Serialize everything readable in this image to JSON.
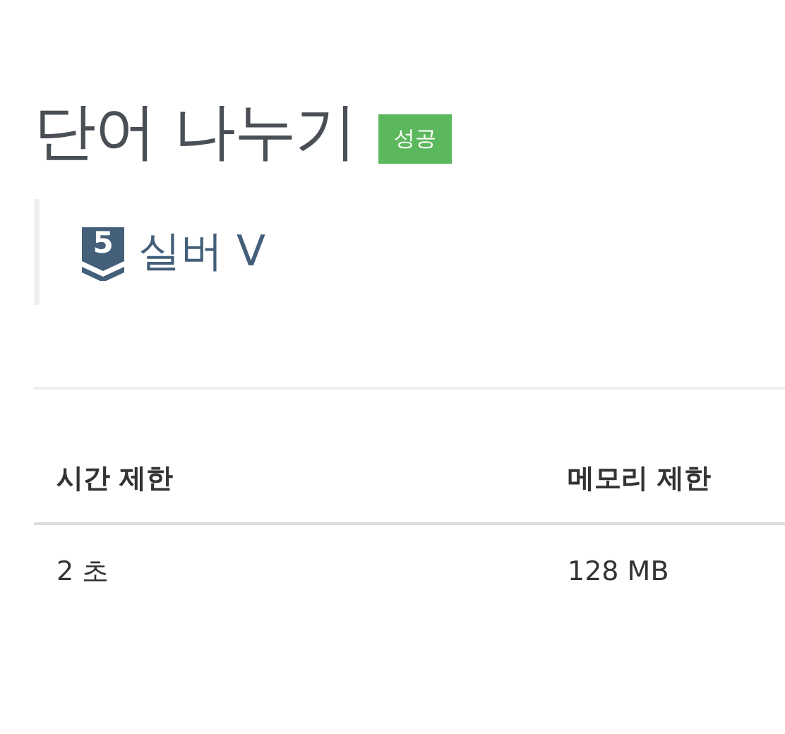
{
  "problem": {
    "title": "단어 나누기",
    "result_badge": {
      "label": "성공",
      "kind": "success"
    }
  },
  "tier": {
    "number": "5",
    "label": "실버 V"
  },
  "limits_table": {
    "columns": [
      "시간 제한",
      "메모리 제한"
    ],
    "rows": [
      [
        "2 초",
        "128 MB"
      ]
    ]
  }
}
